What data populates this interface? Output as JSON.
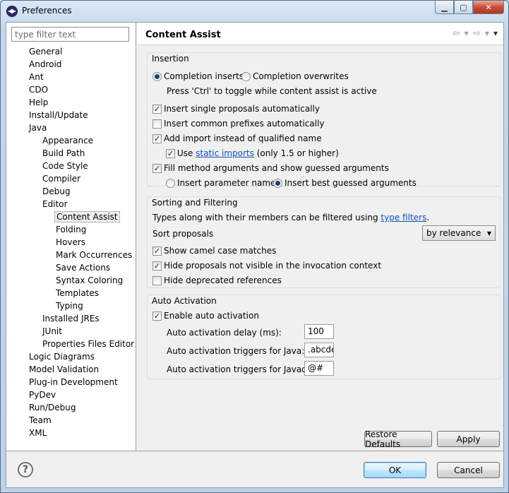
{
  "window": {
    "title": "Preferences",
    "controls": [
      "minimize",
      "maximize",
      "close"
    ]
  },
  "sidebar": {
    "filter_placeholder": "type filter text",
    "items": [
      {
        "label": "General",
        "level": 0
      },
      {
        "label": "Android",
        "level": 0
      },
      {
        "label": "Ant",
        "level": 0
      },
      {
        "label": "CDO",
        "level": 0
      },
      {
        "label": "Help",
        "level": 0
      },
      {
        "label": "Install/Update",
        "level": 0
      },
      {
        "label": "Java",
        "level": 0
      },
      {
        "label": "Appearance",
        "level": 1
      },
      {
        "label": "Build Path",
        "level": 1
      },
      {
        "label": "Code Style",
        "level": 1
      },
      {
        "label": "Compiler",
        "level": 1
      },
      {
        "label": "Debug",
        "level": 1
      },
      {
        "label": "Editor",
        "level": 1
      },
      {
        "label": "Content Assist",
        "level": 2,
        "selected": true
      },
      {
        "label": "Folding",
        "level": 2
      },
      {
        "label": "Hovers",
        "level": 2
      },
      {
        "label": "Mark Occurrences",
        "level": 2
      },
      {
        "label": "Save Actions",
        "level": 2
      },
      {
        "label": "Syntax Coloring",
        "level": 2
      },
      {
        "label": "Templates",
        "level": 2
      },
      {
        "label": "Typing",
        "level": 2
      },
      {
        "label": "Installed JREs",
        "level": 1
      },
      {
        "label": "JUnit",
        "level": 1
      },
      {
        "label": "Properties Files Editor",
        "level": 1
      },
      {
        "label": "Logic Diagrams",
        "level": 0
      },
      {
        "label": "Model Validation",
        "level": 0
      },
      {
        "label": "Plug-in Development",
        "level": 0
      },
      {
        "label": "PyDev",
        "level": 0
      },
      {
        "label": "Run/Debug",
        "level": 0
      },
      {
        "label": "Team",
        "level": 0
      },
      {
        "label": "XML",
        "level": 0
      }
    ]
  },
  "page": {
    "title": "Content Assist",
    "nav_icons": [
      "back-arrow",
      "forward-arrow",
      "view-menu"
    ]
  },
  "insertion": {
    "title": "Insertion",
    "radio_inserts": "Completion inserts",
    "radio_overwrites": "Completion overwrites",
    "radio_inserts_checked": true,
    "toggle_hint": "Press 'Ctrl' to toggle while content assist is active",
    "single_proposals": "Insert single proposals automatically",
    "common_prefixes": "Insert common prefixes automatically",
    "add_import": "Add import instead of qualified name",
    "use_label": "Use",
    "static_imports_link": "static imports",
    "static_imports_suffix": "(only 1.5 or higher)",
    "fill_arguments": "Fill method arguments and show guessed arguments",
    "insert_param_names": "Insert parameter names",
    "insert_best_guessed": "Insert best guessed arguments"
  },
  "sorting": {
    "title": "Sorting and Filtering",
    "description_prefix": "Types along with their members can be filtered using",
    "type_filters_link": "type filters",
    "description_suffix": ".",
    "sort_label": "Sort proposals",
    "sort_value": "by relevance",
    "camel_case": "Show camel case matches",
    "hide_not_visible": "Hide proposals not visible in the invocation context",
    "hide_deprecated": "Hide deprecated references"
  },
  "auto_activation": {
    "title": "Auto Activation",
    "enable": "Enable auto activation",
    "delay_label": "Auto activation delay (ms):",
    "delay_value": "100",
    "java_label": "Auto activation triggers for Java:",
    "java_value": ".abcde",
    "javadoc_label": "Auto activation triggers for Javadoc:",
    "javadoc_value": "@#"
  },
  "buttons": {
    "restore_defaults": "Restore Defaults",
    "apply": "Apply",
    "ok": "OK",
    "cancel": "Cancel"
  },
  "checkmark": "✓"
}
